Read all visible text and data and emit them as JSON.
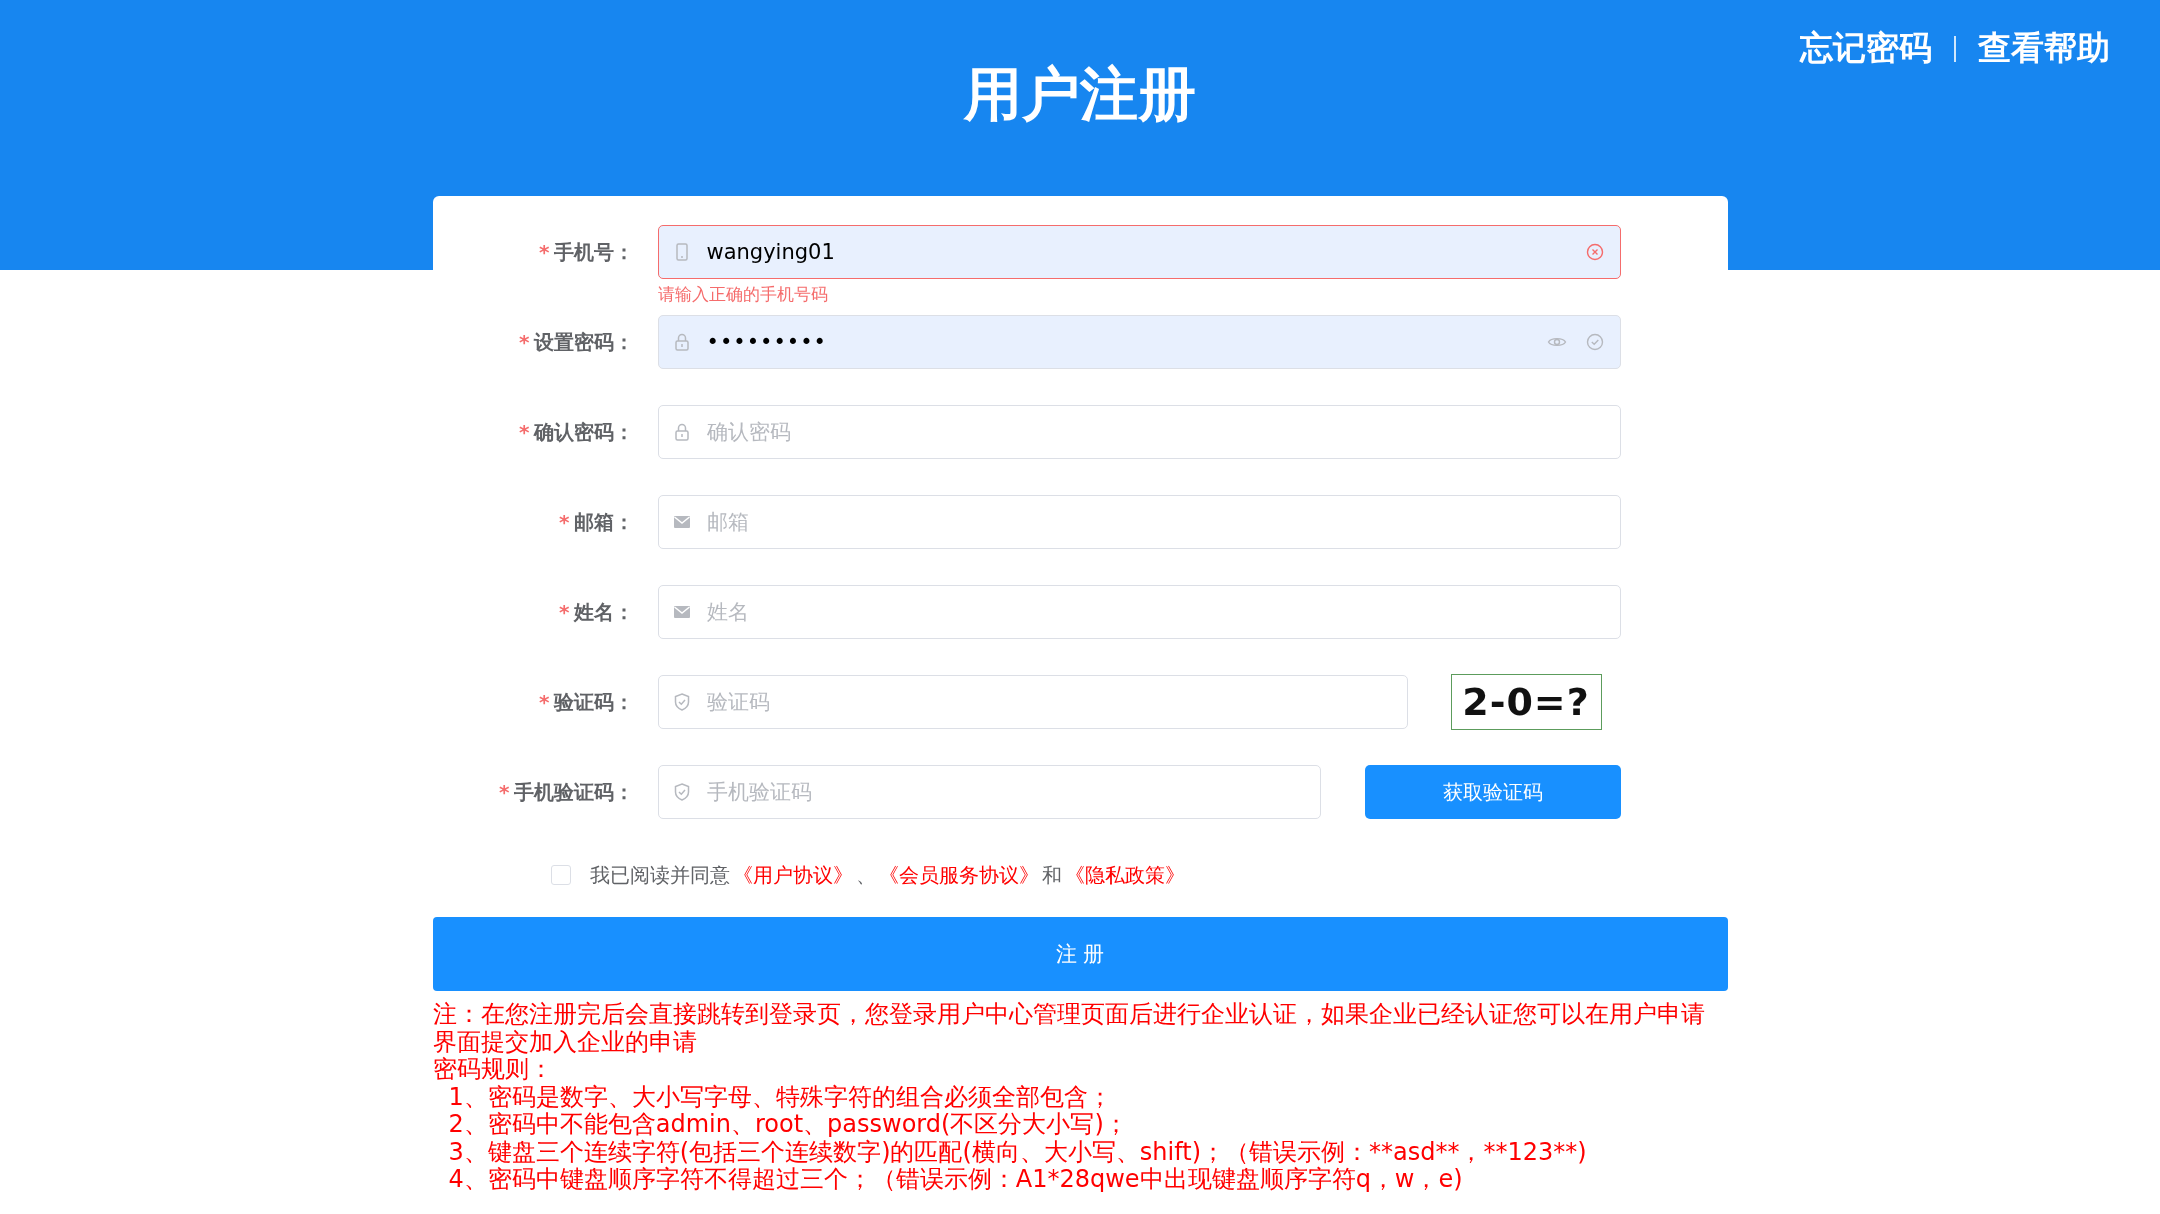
{
  "header": {
    "title": "用户注册",
    "links": [
      {
        "label": "忘记密码"
      },
      {
        "label": "查看帮助"
      }
    ]
  },
  "fields": [
    {
      "kind": "phone",
      "marker": "*",
      "label": "手机号：",
      "value": "wangying01",
      "invalid": true,
      "error": "请输入正确的手机号码",
      "clearable": true
    },
    {
      "kind": "password",
      "marker": "*",
      "label": "设置密码：",
      "value": "•••••••••",
      "invalid": false,
      "revealable": true,
      "valid": true
    },
    {
      "kind": "password",
      "marker": "*",
      "label": "确认密码：",
      "placeholder": "确认密码",
      "invalid": false
    },
    {
      "kind": "email",
      "marker": "*",
      "label": "邮箱：",
      "placeholder": "邮箱",
      "invalid": false
    },
    {
      "kind": "email",
      "marker": "*",
      "label": "姓名：",
      "placeholder": "姓名",
      "invalid": false
    },
    {
      "kind": "captcha",
      "marker": "*",
      "label": "验证码：",
      "placeholder": "验证码",
      "invalid": false,
      "captcha_text": "2-0=?"
    },
    {
      "kind": "sms",
      "marker": "*",
      "label": "手机验证码：",
      "placeholder": "手机验证码",
      "invalid": false,
      "button": "获取验证码"
    }
  ],
  "agreement": {
    "checked": false,
    "parts": [
      {
        "text": "我已阅读并同意",
        "link": false
      },
      {
        "text": "《用户协议》",
        "link": true
      },
      {
        "text": "、",
        "link": false
      },
      {
        "text": "《会员服务协议》",
        "link": true
      },
      {
        "text": "和",
        "link": false
      },
      {
        "text": "《隐私政策》",
        "link": true
      }
    ]
  },
  "submit": "注 册",
  "notes": [
    "注：在您注册完后会直接跳转到登录页，您登录用户中心管理页面后进行企业认证，如果企业已经认证您可以在用户申请界面提交加入企业的申请",
    "密码规则："
  ],
  "rules": [
    "1、密码是数字、大小写字母、特殊字符的组合必须全部包含；",
    "2、密码中不能包含admin、root、password(不区分大小写)；",
    "3、键盘三个连续字符(包括三个连续数字)的匹配(横向、大小写、shift)；（错误示例：**asd**，**123**)",
    "4、密码中键盘顺序字符不得超过三个；（错误示例：A1*28qwe中出现键盘顺序字符q，w，e)"
  ]
}
